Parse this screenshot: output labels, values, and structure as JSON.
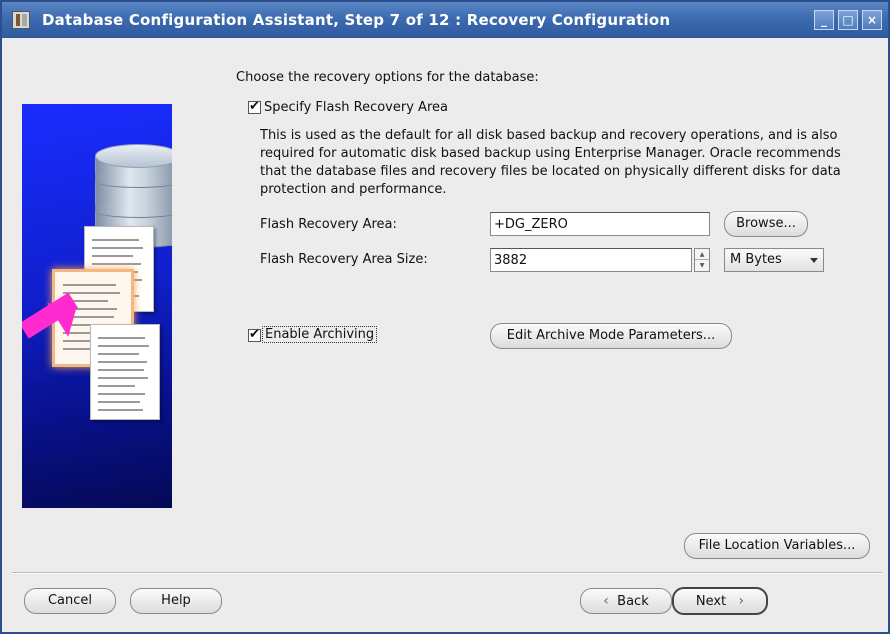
{
  "window": {
    "title": "Database Configuration Assistant, Step 7 of 12 : Recovery Configuration",
    "controls": {
      "minimize": "_",
      "maximize": "□",
      "close": "×"
    }
  },
  "content": {
    "prompt": "Choose the recovery options for the database:",
    "flash_recovery": {
      "checkbox_label": "Specify Flash Recovery Area",
      "checked": true,
      "description": "This is used as the default for all disk based backup and recovery operations, and is also required for automatic disk based backup using Enterprise Manager. Oracle recommends that the database files and recovery files be located on physically different disks for data protection and performance.",
      "area_label": "Flash Recovery Area:",
      "area_value": "+DG_ZERO",
      "browse_label": "Browse...",
      "size_label": "Flash Recovery Area Size:",
      "size_value": "3882",
      "size_unit": "M Bytes"
    },
    "archiving": {
      "checkbox_label": "Enable Archiving",
      "checked": true,
      "edit_params_label": "Edit Archive Mode Parameters..."
    },
    "file_location_variables_label": "File Location Variables..."
  },
  "footer": {
    "cancel_label": "Cancel",
    "help_label": "Help",
    "back_label": "Back",
    "next_label": "Next",
    "back_icon": "‹",
    "next_icon": "›"
  },
  "colors": {
    "titlebar": "#3d6bb0",
    "illustration_blue": "#1a2cff",
    "arrow_magenta": "#ff2ad0"
  }
}
